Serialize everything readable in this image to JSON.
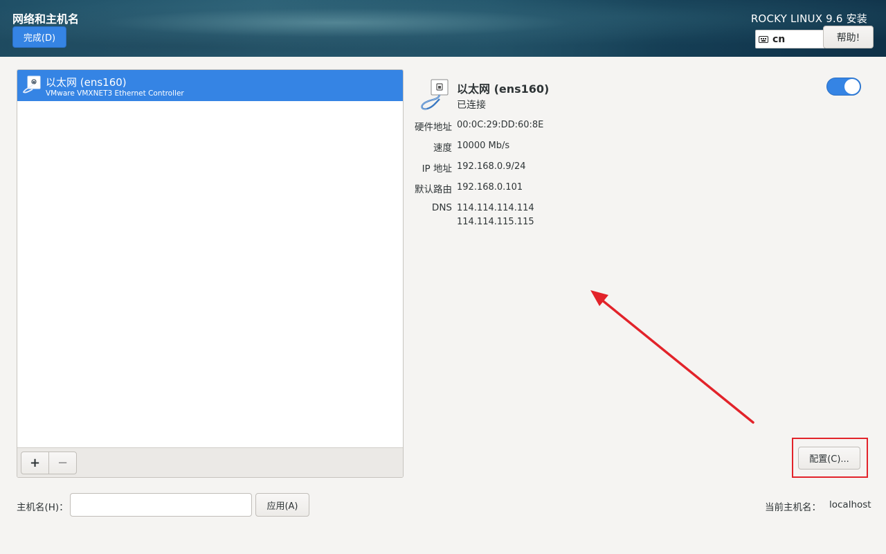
{
  "header": {
    "title": "网络和主机名",
    "done_label": "完成(D)",
    "product": "ROCKY LINUX 9.6 安装",
    "keyboard_layout": "cn",
    "help_label": "帮助!"
  },
  "device_list": {
    "items": [
      {
        "name": "以太网 (ens160)",
        "description": "VMware VMXNET3 Ethernet Controller",
        "selected": true,
        "icon": "ethernet-icon"
      }
    ],
    "add_label": "+",
    "remove_label": "−"
  },
  "detail": {
    "name": "以太网 (ens160)",
    "status": "已连接",
    "enabled": true,
    "icon": "ethernet-icon",
    "rows": [
      {
        "label": "硬件地址",
        "value": "00:0C:29:DD:60:8E"
      },
      {
        "label": "速度",
        "value": "10000 Mb/s"
      },
      {
        "label": "IP 地址",
        "value": "192.168.0.9/24"
      },
      {
        "label": "默认路由",
        "value": "192.168.0.101"
      },
      {
        "label": "DNS",
        "value": "114.114.114.114",
        "value2": "114.114.115.115"
      }
    ],
    "configure_label": "配置(C)..."
  },
  "hostname": {
    "label": "主机名(H)：",
    "value": "",
    "placeholder": "",
    "apply_label": "应用(A)",
    "current_label": "当前主机名：",
    "current_value": "localhost"
  },
  "colors": {
    "accent": "#3584e4",
    "annotation": "#e2232a"
  }
}
